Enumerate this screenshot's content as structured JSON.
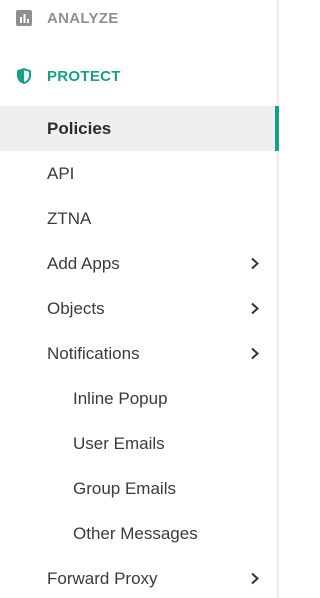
{
  "colors": {
    "accent": "#1c9e86",
    "muted_section": "#8f8f8f",
    "text": "#3a3a3a",
    "active_bg": "#efefef"
  },
  "sections": {
    "analyze": {
      "label": "ANALYZE",
      "icon": "bar-chart-icon"
    },
    "protect": {
      "label": "PROTECT",
      "icon": "shield-icon"
    }
  },
  "items": [
    {
      "label": "Policies",
      "active": true,
      "has_children": false
    },
    {
      "label": "API",
      "active": false,
      "has_children": false
    },
    {
      "label": "ZTNA",
      "active": false,
      "has_children": false
    },
    {
      "label": "Add Apps",
      "active": false,
      "has_children": true
    },
    {
      "label": "Objects",
      "active": false,
      "has_children": true
    },
    {
      "label": "Notifications",
      "active": false,
      "has_children": true,
      "expanded": true
    },
    {
      "label": "Inline Popup",
      "active": false,
      "has_children": false,
      "level": 2
    },
    {
      "label": "User Emails",
      "active": false,
      "has_children": false,
      "level": 2
    },
    {
      "label": "Group Emails",
      "active": false,
      "has_children": false,
      "level": 2
    },
    {
      "label": "Other Messages",
      "active": false,
      "has_children": false,
      "level": 2
    },
    {
      "label": "Forward Proxy",
      "active": false,
      "has_children": true
    }
  ]
}
